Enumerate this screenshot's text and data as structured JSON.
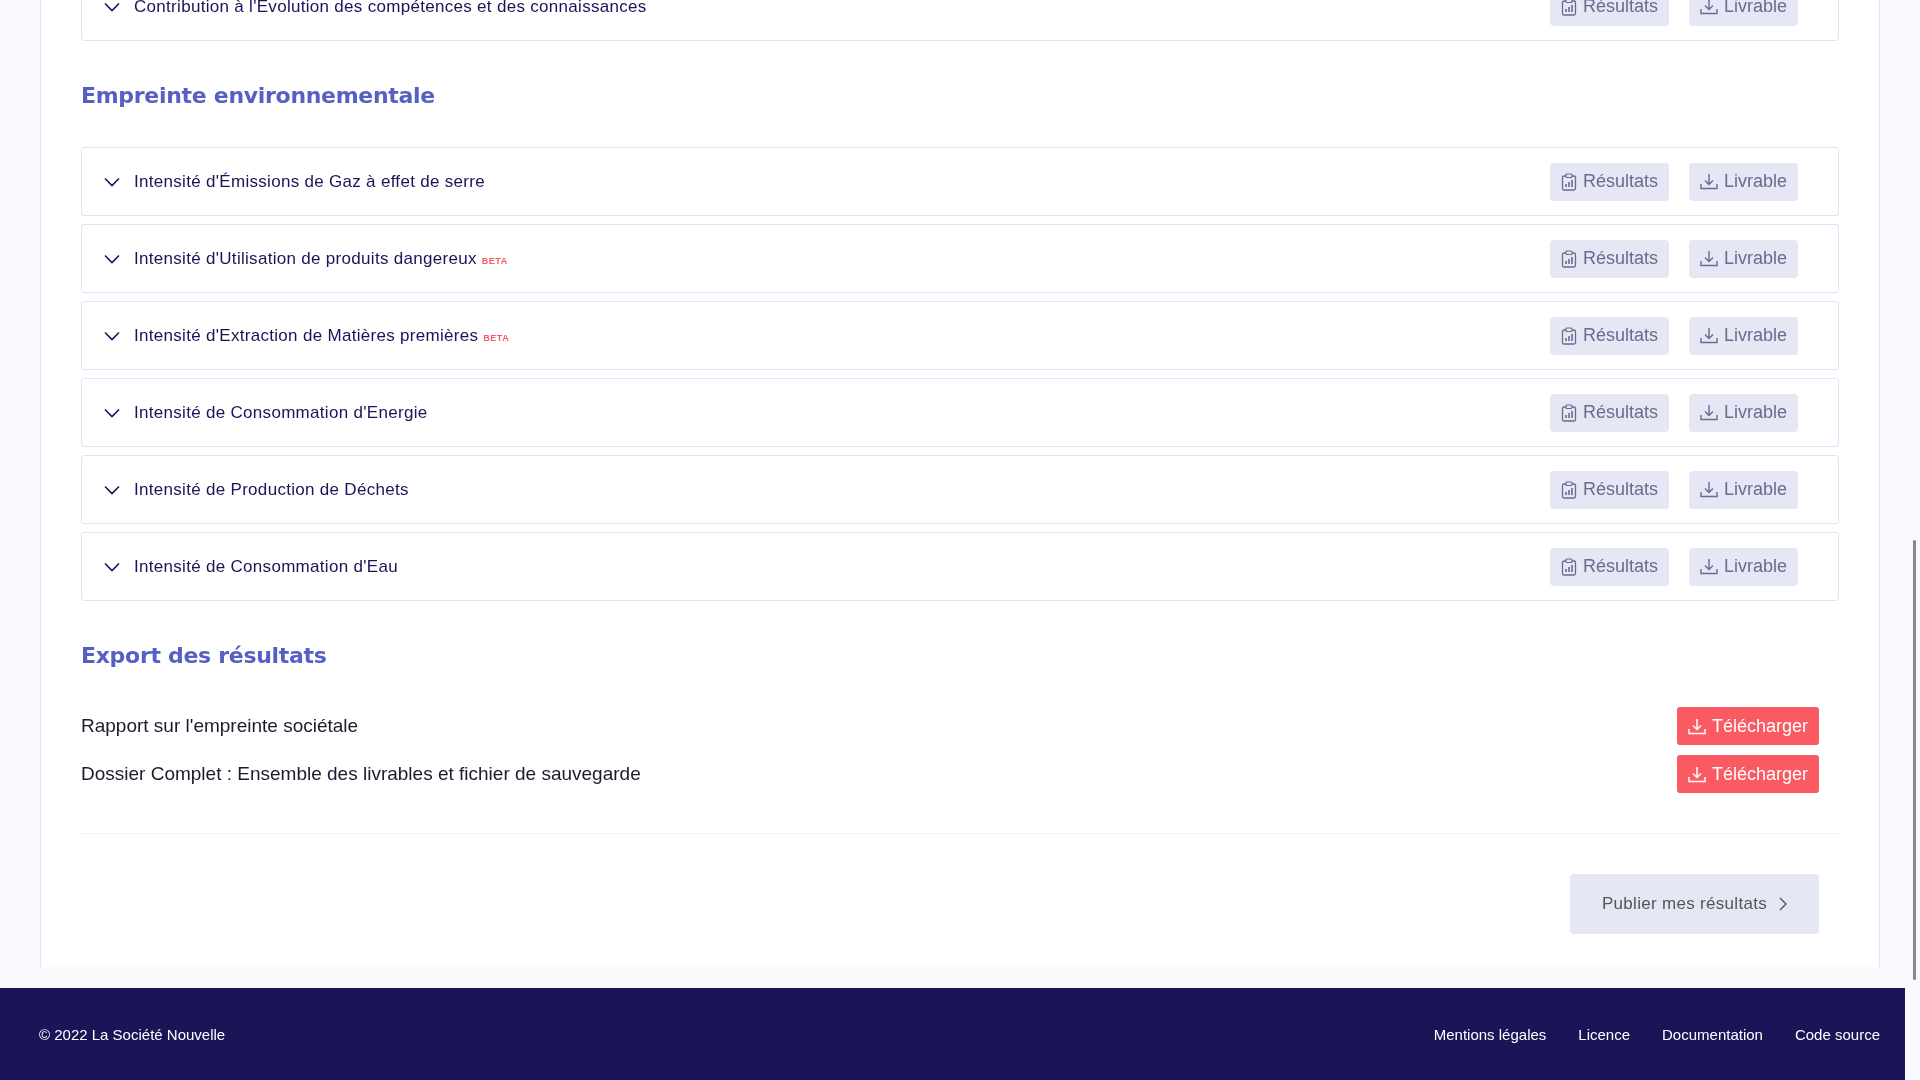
{
  "indicator_groups": [
    {
      "rows": [
        {
          "label": "Contribution à l'Evolution des compétences et des connaissances",
          "expanded": false,
          "buttons": [
            "Résultats",
            "Livrable"
          ]
        }
      ]
    },
    {
      "heading": "Empreinte environnementale",
      "rows": [
        {
          "label": "Intensité d'Émissions de Gaz à effet de serre",
          "expanded": false,
          "buttons": [
            "Résultats",
            "Livrable"
          ]
        },
        {
          "label": "Intensité d'Utilisation de produits dangereux",
          "badge": "BETA",
          "expanded": false,
          "buttons": [
            "Résultats",
            "Livrable"
          ]
        },
        {
          "label": "Intensité d'Extraction de Matières premières",
          "badge": "BETA",
          "expanded": false,
          "buttons": [
            "Résultats",
            "Livrable"
          ]
        },
        {
          "label": "Intensité de Consommation d'Energie",
          "expanded": false,
          "buttons": [
            "Résultats",
            "Livrable"
          ]
        },
        {
          "label": "Intensité de Production de Déchets",
          "expanded": false,
          "buttons": [
            "Résultats",
            "Livrable"
          ]
        },
        {
          "label": "Intensité de Consommation d'Eau",
          "expanded": false,
          "buttons": [
            "Résultats",
            "Livrable"
          ]
        }
      ]
    }
  ],
  "export": {
    "heading": "Export des résultats",
    "items": [
      {
        "label": "Rapport sur l'empreinte sociétale",
        "button": "Télécharger"
      },
      {
        "label": "Dossier Complet : Ensemble des livrables et fichier de sauvegarde",
        "button": "Télécharger"
      }
    ]
  },
  "publish_button": "Publier mes résultats",
  "footer": {
    "copyright": "© 2022 La Société Nouvelle",
    "links": [
      "Mentions légales",
      "Licence",
      "Documentation",
      "Code source"
    ]
  }
}
